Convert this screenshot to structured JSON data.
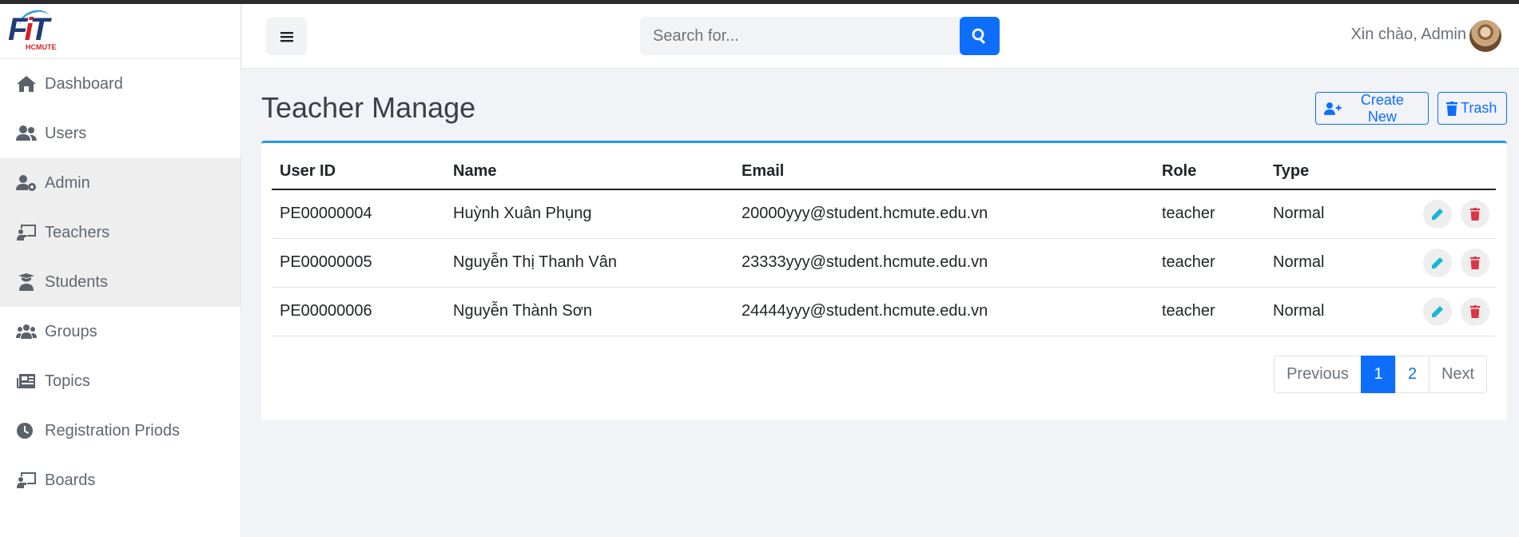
{
  "brand": {
    "logo_text": "FIT",
    "logo_sub": "HCMUTE"
  },
  "sidebar": {
    "items": [
      {
        "label": "Dashboard",
        "icon": "home-icon"
      },
      {
        "label": "Users",
        "icon": "users-icon"
      },
      {
        "label": "Admin",
        "icon": "user-gear-icon"
      },
      {
        "label": "Teachers",
        "icon": "chalkboard-teacher-icon"
      },
      {
        "label": "Students",
        "icon": "graduate-icon"
      },
      {
        "label": "Groups",
        "icon": "group-icon"
      },
      {
        "label": "Topics",
        "icon": "newspaper-icon"
      },
      {
        "label": "Registration Priods",
        "icon": "clock-icon"
      },
      {
        "label": "Boards",
        "icon": "chalkboard-teacher-icon"
      }
    ]
  },
  "header": {
    "search_placeholder": "Search for...",
    "greeting": "Xin chào, Admin"
  },
  "main": {
    "title": "Teacher Manage",
    "create_label": "Create New",
    "trash_label": "Trash",
    "table": {
      "headers": [
        "User ID",
        "Name",
        "Email",
        "Role",
        "Type"
      ],
      "rows": [
        [
          "PE00000004",
          "Huỳnh Xuân Phụng",
          "20000yyy@student.hcmute.edu.vn",
          "teacher",
          "Normal"
        ],
        [
          "PE00000005",
          "Nguyễn Thị Thanh Vân",
          "23333yyy@student.hcmute.edu.vn",
          "teacher",
          "Normal"
        ],
        [
          "PE00000006",
          "Nguyễn Thành Sơn",
          "24444yyy@student.hcmute.edu.vn",
          "teacher",
          "Normal"
        ]
      ]
    },
    "pagination": {
      "previous": "Previous",
      "pages": [
        "1",
        "2"
      ],
      "active": "1",
      "next": "Next"
    }
  },
  "colors": {
    "accent": "#0d6efd",
    "card_top": "#2597e9",
    "danger": "#dc3545",
    "edit": "#18b6d8"
  }
}
